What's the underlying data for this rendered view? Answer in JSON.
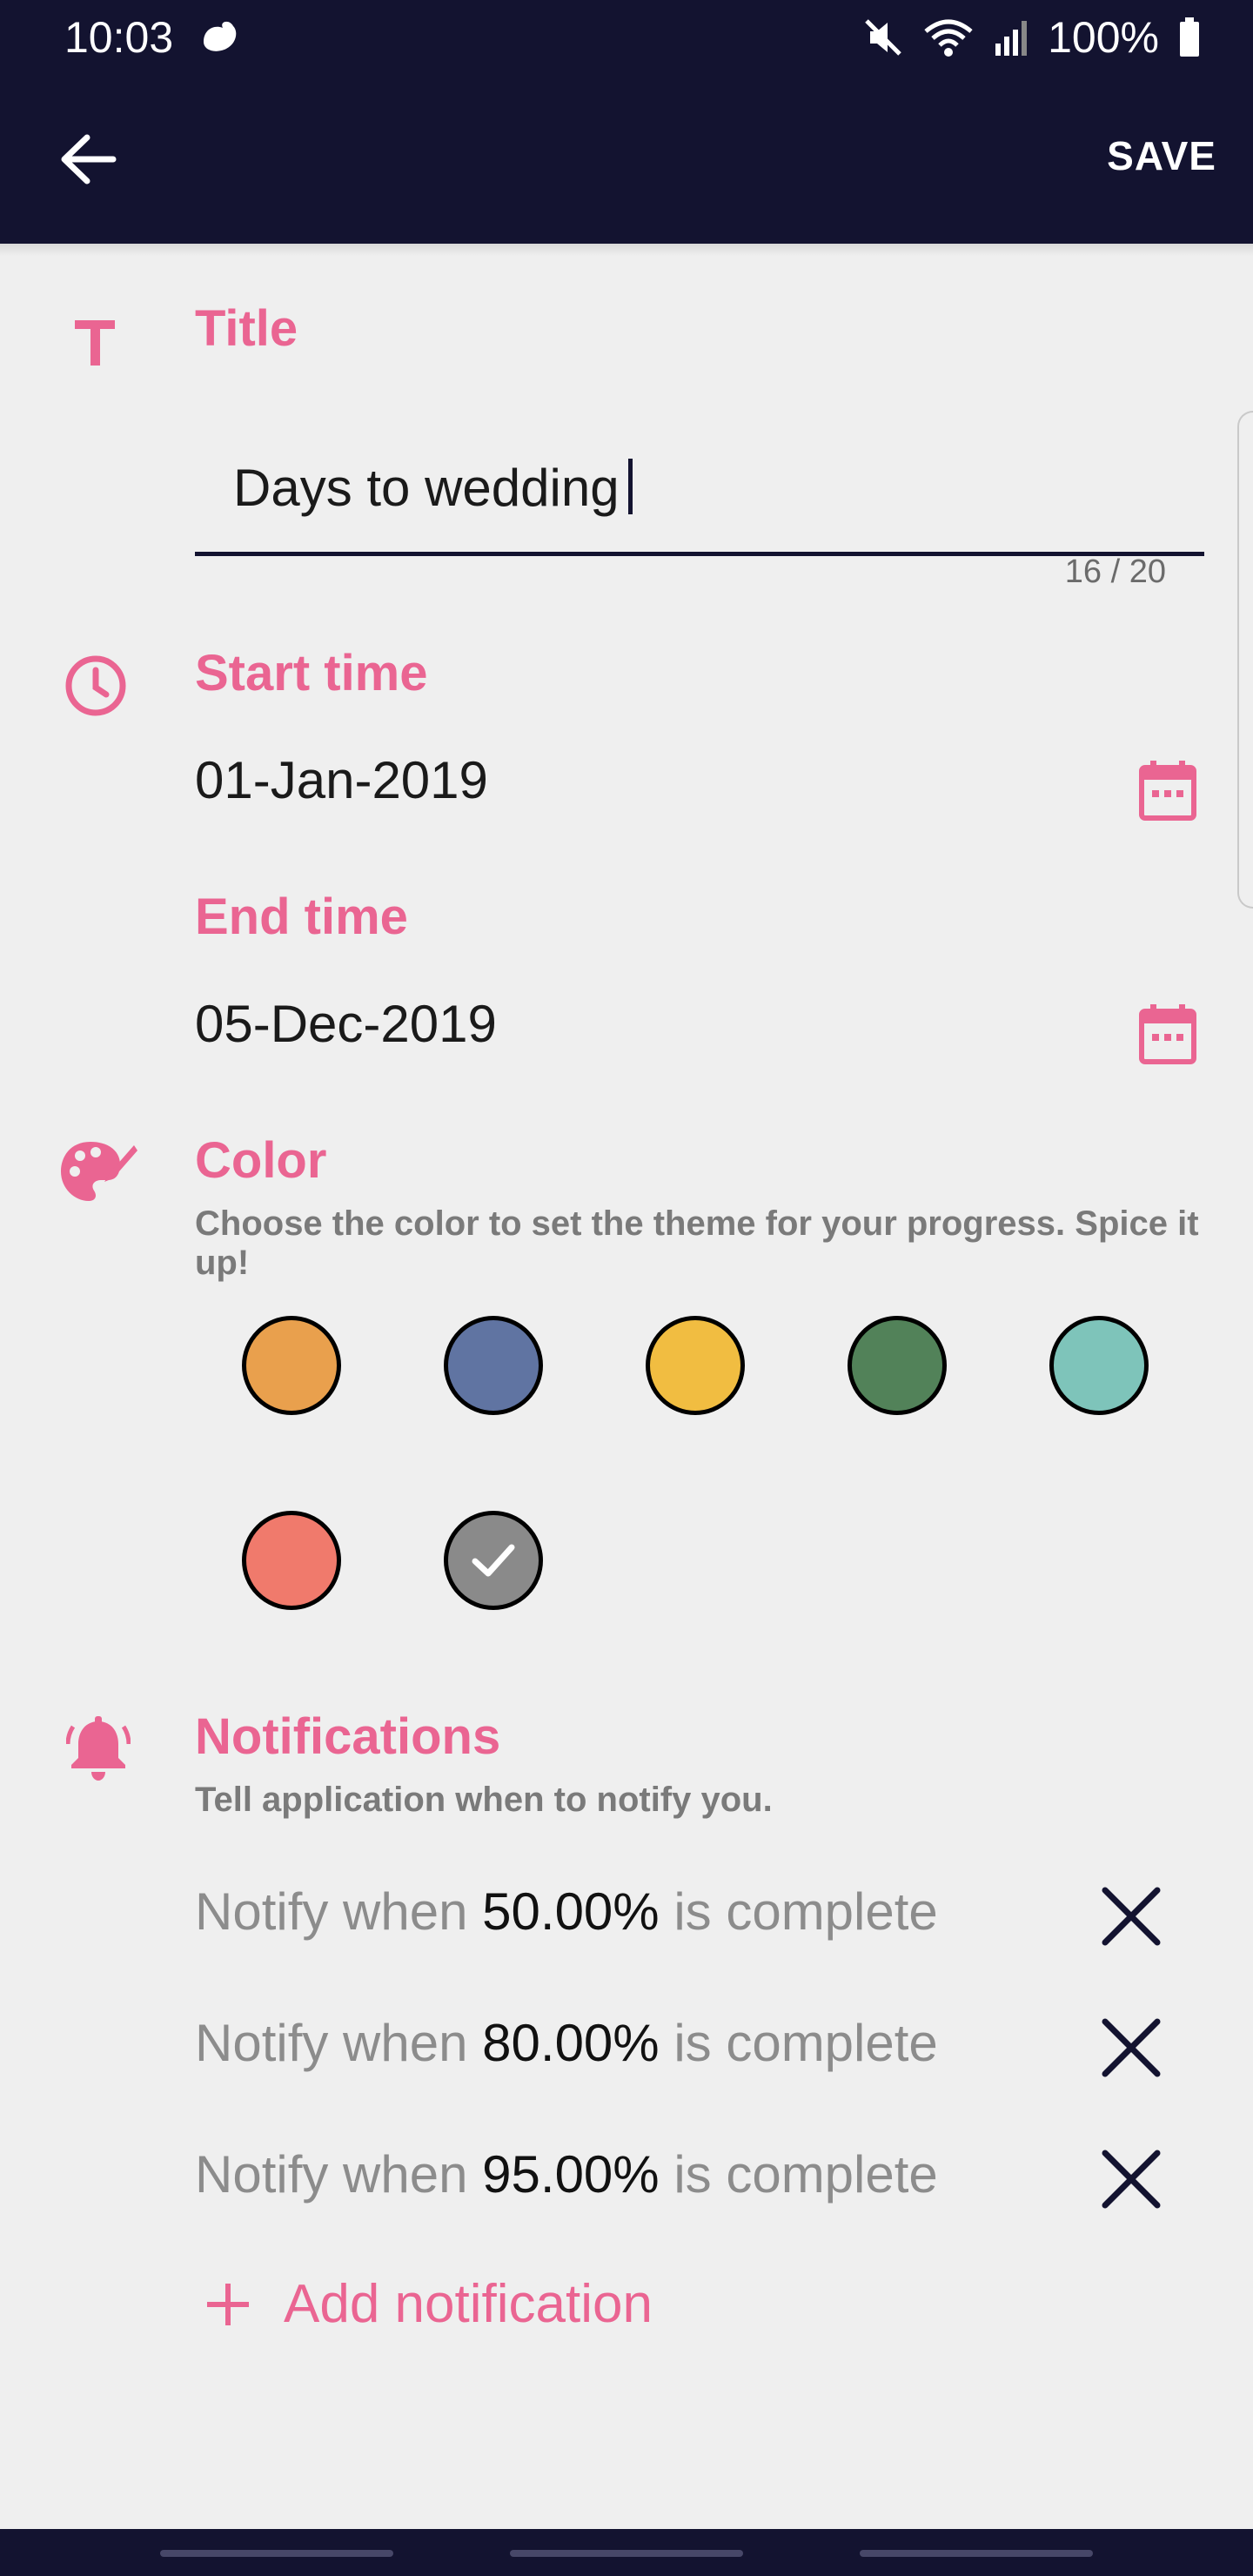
{
  "status": {
    "time": "10:03",
    "battery": "100%"
  },
  "toolbar": {
    "save_label": "SAVE"
  },
  "title_section": {
    "label": "Title",
    "value": "Days to wedding",
    "counter": "16 / 20"
  },
  "start": {
    "label": "Start time",
    "value": "01-Jan-2019"
  },
  "end": {
    "label": "End time",
    "value": "05-Dec-2019"
  },
  "color_section": {
    "label": "Color",
    "description": "Choose the color to set the theme for your progress. Spice it up!",
    "swatches": [
      "#e9a04d",
      "#6074a2",
      "#f1bd41",
      "#528259",
      "#7ec4ba",
      "#f07a6c",
      "#8a8a8a"
    ],
    "selected_index": 6
  },
  "notifications": {
    "label": "Notifications",
    "description": "Tell application when to notify you.",
    "prefix": "Notify when",
    "suffix": "is complete",
    "items": [
      {
        "percent": "50.00%"
      },
      {
        "percent": "80.00%"
      },
      {
        "percent": "95.00%"
      }
    ],
    "add_label": "Add notification"
  },
  "colors": {
    "accent": "#ea6592",
    "toolbar": "#131330"
  }
}
